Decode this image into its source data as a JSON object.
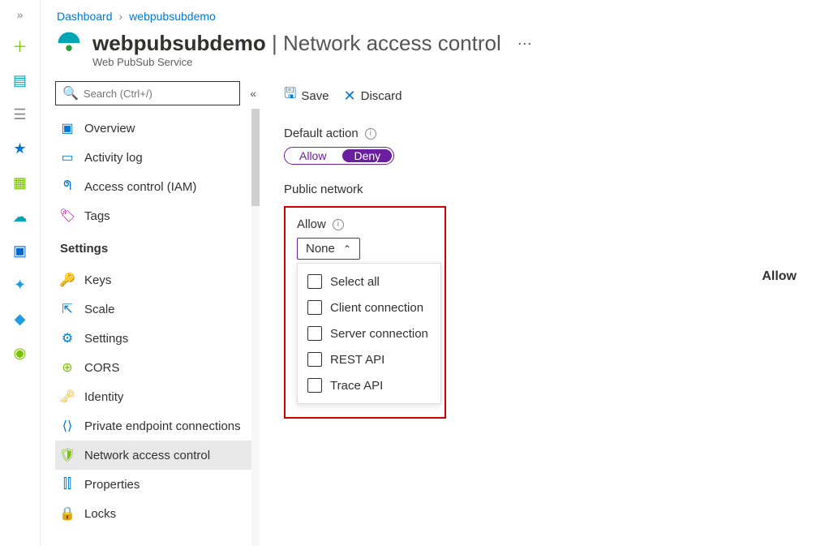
{
  "breadcrumbs": {
    "a": "Dashboard",
    "b": "webpubsubdemo"
  },
  "header": {
    "resource": "webpubsubdemo",
    "page": "Network access control",
    "service": "Web PubSub Service"
  },
  "sidebar": {
    "search_placeholder": "Search (Ctrl+/)",
    "overview": "Overview",
    "activity": "Activity log",
    "iam": "Access control (IAM)",
    "tags": "Tags",
    "settings_section": "Settings",
    "keys": "Keys",
    "scale": "Scale",
    "settings": "Settings",
    "cors": "CORS",
    "identity": "Identity",
    "pec": "Private endpoint connections",
    "nac": "Network access control",
    "props": "Properties",
    "locks": "Locks"
  },
  "toolbar": {
    "save": "Save",
    "discard": "Discard"
  },
  "content": {
    "default_action": "Default action",
    "allow": "Allow",
    "deny": "Deny",
    "public_network": "Public network",
    "allow_label": "Allow",
    "dd_value": "None",
    "opts": {
      "selectall": "Select all",
      "client": "Client connection",
      "server": "Server connection",
      "rest": "REST API",
      "trace": "Trace API"
    },
    "col_allow": "Allow"
  }
}
